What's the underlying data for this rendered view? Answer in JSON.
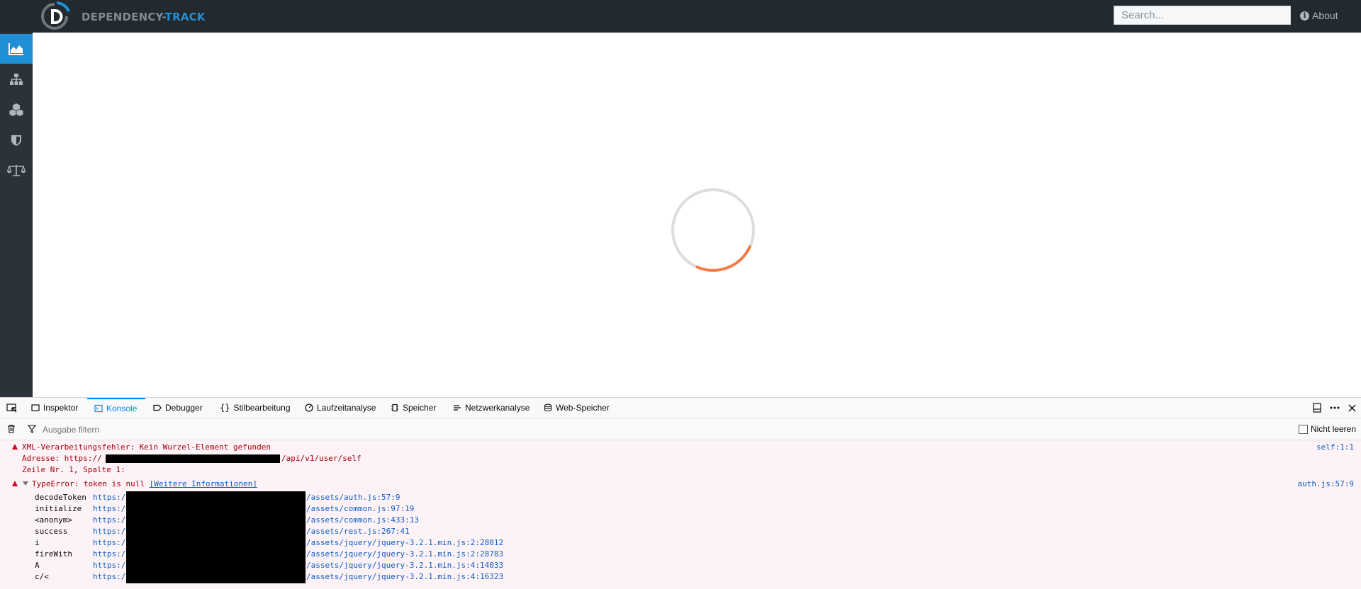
{
  "app": {
    "brand_part1": "DEPENDENCY-",
    "brand_part2": "TRACK",
    "search_placeholder": "Search...",
    "about_label": "About",
    "accent": "#1f8fd6",
    "spinner_color": "#f47c48"
  },
  "sidebar": {
    "items": [
      {
        "icon": "dashboard-chart-icon",
        "active": true
      },
      {
        "icon": "projects-sitemap-icon",
        "active": false
      },
      {
        "icon": "components-cubes-icon",
        "active": false
      },
      {
        "icon": "vulnerabilities-shield-icon",
        "active": false
      },
      {
        "icon": "licenses-balance-scale-icon",
        "active": false
      }
    ]
  },
  "devtools": {
    "tabs": [
      {
        "label": "Inspektor",
        "icon": "inspector-icon"
      },
      {
        "label": "Konsole",
        "icon": "console-icon",
        "selected": true
      },
      {
        "label": "Debugger",
        "icon": "debugger-icon"
      },
      {
        "label": "Stilbearbeitung",
        "icon": "braces-icon"
      },
      {
        "label": "Laufzeitanalyse",
        "icon": "performance-icon"
      },
      {
        "label": "Speicher",
        "icon": "memory-icon"
      },
      {
        "label": "Netzwerkanalyse",
        "icon": "network-icon"
      },
      {
        "label": "Web-Speicher",
        "icon": "storage-icon"
      }
    ],
    "filter_placeholder": "Ausgabe filtern",
    "persist_label": "Nicht leeren",
    "messages": {
      "xml_error": {
        "title": "XML-Verarbeitungsfehler: Kein Wurzel-Element gefunden",
        "address_prefix": "Adresse: https://",
        "address_suffix": "/api/v1/user/self",
        "position": "Zeile Nr. 1, Spalte 1:",
        "source": "self:1:1"
      },
      "type_error": {
        "title": "TypeError: token is null",
        "more_info": "[Weitere Informationen]",
        "source": "auth.js:57:9",
        "stack": [
          {
            "fn": "decodeToken",
            "url_prefix": "https:/",
            "url_suffix": "/assets/auth.js:57:9"
          },
          {
            "fn": "initialize",
            "url_prefix": "https:/",
            "url_suffix": "/assets/common.js:97:19"
          },
          {
            "fn": "<anonym>",
            "url_prefix": "https:/",
            "url_suffix": "/assets/common.js:433:13"
          },
          {
            "fn": "success",
            "url_prefix": "https:/",
            "url_suffix": "/assets/rest.js:267:41"
          },
          {
            "fn": "i",
            "url_prefix": "https:/",
            "url_suffix": "/assets/jquery/jquery-3.2.1.min.js:2:28012"
          },
          {
            "fn": "fireWith",
            "url_prefix": "https:/",
            "url_suffix": "/assets/jquery/jquery-3.2.1.min.js:2:28783"
          },
          {
            "fn": "A",
            "url_prefix": "https:/",
            "url_suffix": "/assets/jquery/jquery-3.2.1.min.js:4:14033"
          },
          {
            "fn": "c/<",
            "url_prefix": "https:/",
            "url_suffix": "/assets/jquery/jquery-3.2.1.min.js:4:16323"
          }
        ]
      }
    }
  }
}
